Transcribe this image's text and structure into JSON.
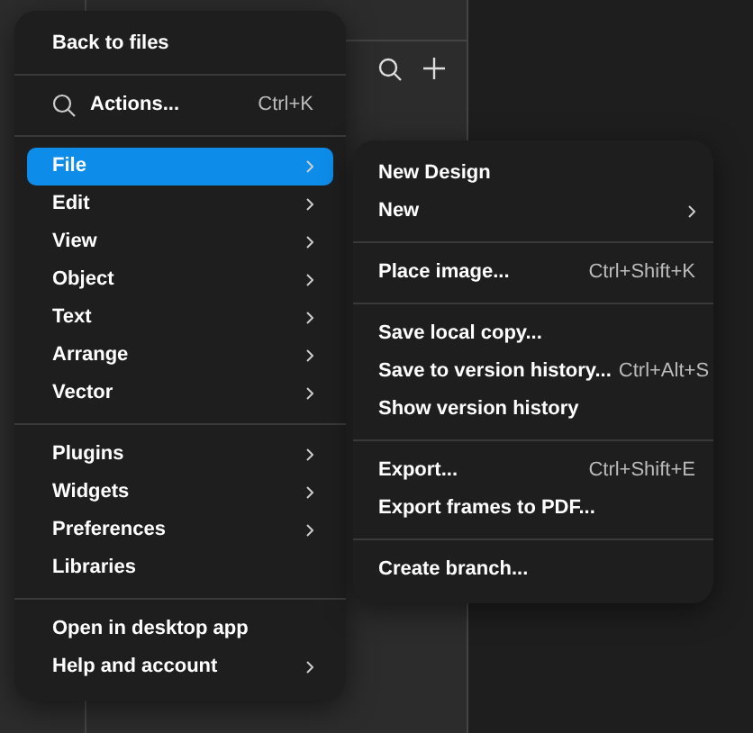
{
  "main_menu": {
    "sections": [
      {
        "items": [
          {
            "label": "Back to files",
            "icon": false,
            "submenu": false,
            "selected": false
          }
        ]
      },
      {
        "items": [
          {
            "label": "Actions...",
            "shortcut": "Ctrl+K",
            "icon": true,
            "submenu": false,
            "selected": false
          }
        ]
      },
      {
        "items": [
          {
            "label": "File",
            "submenu": true,
            "selected": true
          },
          {
            "label": "Edit",
            "submenu": true,
            "selected": false
          },
          {
            "label": "View",
            "submenu": true,
            "selected": false
          },
          {
            "label": "Object",
            "submenu": true,
            "selected": false
          },
          {
            "label": "Text",
            "submenu": true,
            "selected": false
          },
          {
            "label": "Arrange",
            "submenu": true,
            "selected": false
          },
          {
            "label": "Vector",
            "submenu": true,
            "selected": false
          }
        ]
      },
      {
        "items": [
          {
            "label": "Plugins",
            "submenu": true,
            "selected": false
          },
          {
            "label": "Widgets",
            "submenu": true,
            "selected": false
          },
          {
            "label": "Preferences",
            "submenu": true,
            "selected": false
          },
          {
            "label": "Libraries",
            "submenu": false,
            "selected": false
          }
        ]
      },
      {
        "items": [
          {
            "label": "Open in desktop app",
            "submenu": false,
            "selected": false
          },
          {
            "label": "Help and account",
            "submenu": true,
            "selected": false
          }
        ]
      }
    ]
  },
  "file_submenu": {
    "sections": [
      {
        "items": [
          {
            "label": "New Design",
            "submenu": false
          },
          {
            "label": "New",
            "submenu": true
          }
        ]
      },
      {
        "items": [
          {
            "label": "Place image...",
            "shortcut": "Ctrl+Shift+K",
            "submenu": false
          }
        ]
      },
      {
        "items": [
          {
            "label": "Save local copy...",
            "submenu": false
          },
          {
            "label": "Save to version history...",
            "shortcut": "Ctrl+Alt+S",
            "submenu": false
          },
          {
            "label": "Show version history",
            "submenu": false
          }
        ]
      },
      {
        "items": [
          {
            "label": "Export...",
            "shortcut": "Ctrl+Shift+E",
            "submenu": false
          },
          {
            "label": "Export frames to PDF...",
            "submenu": false
          }
        ]
      },
      {
        "items": [
          {
            "label": "Create branch...",
            "submenu": false
          }
        ]
      }
    ]
  }
}
